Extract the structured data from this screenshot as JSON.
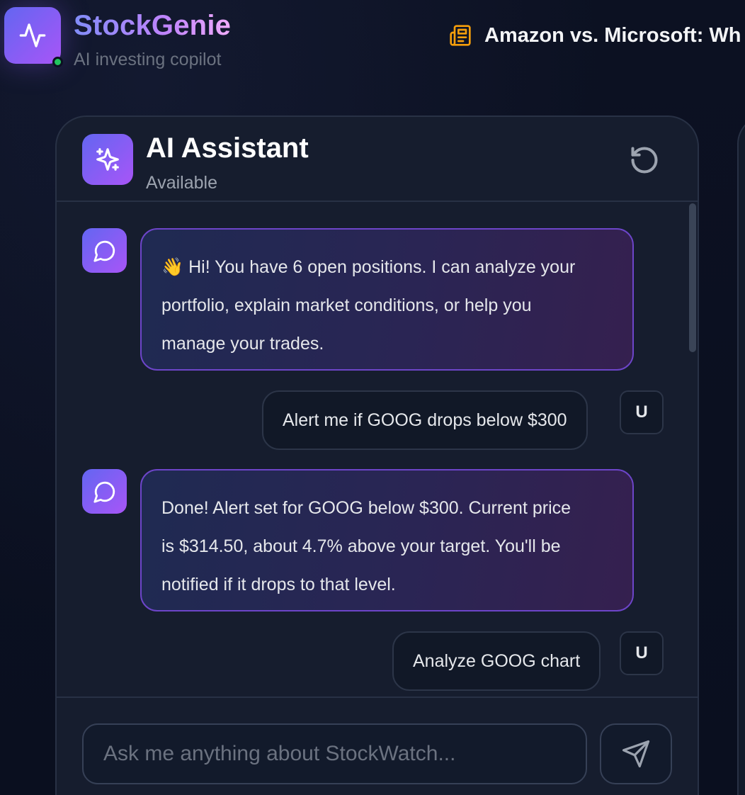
{
  "app": {
    "name": "StockGenie",
    "tagline": "AI investing copilot",
    "logo_icon": "activity-icon",
    "status": "online"
  },
  "news_ticker": {
    "icon": "newspaper-icon",
    "headline": "Amazon vs. Microsoft: Wh"
  },
  "chat": {
    "title": "AI Assistant",
    "status": "Available",
    "reset_icon": "rotate-ccw-icon",
    "messages": [
      {
        "role": "assistant",
        "emoji": "👋",
        "lines": [
          "Hi! You have 6 open positions. I can analyze your",
          "portfolio, explain market conditions, or help you",
          "manage your trades."
        ]
      },
      {
        "role": "user",
        "text": "Alert me if GOOG drops below $300",
        "avatar": "U"
      },
      {
        "role": "assistant",
        "lines": [
          "Done! Alert set for GOOG below $300. Current price",
          "is $314.50, about 4.7% above your target. You'll be",
          "notified if it drops to that level."
        ]
      },
      {
        "role": "user",
        "text": "Analyze GOOG chart",
        "avatar": "U"
      }
    ],
    "input": {
      "placeholder": "Ask me anything about StockWatch...",
      "value": ""
    },
    "send_icon": "send-icon"
  },
  "colors": {
    "accent_start": "#6366f1",
    "accent_end": "#a855f7",
    "background": "#0b1020",
    "panel": "#161d2e",
    "online": "#22c55e",
    "news_icon": "#f59e0b"
  }
}
